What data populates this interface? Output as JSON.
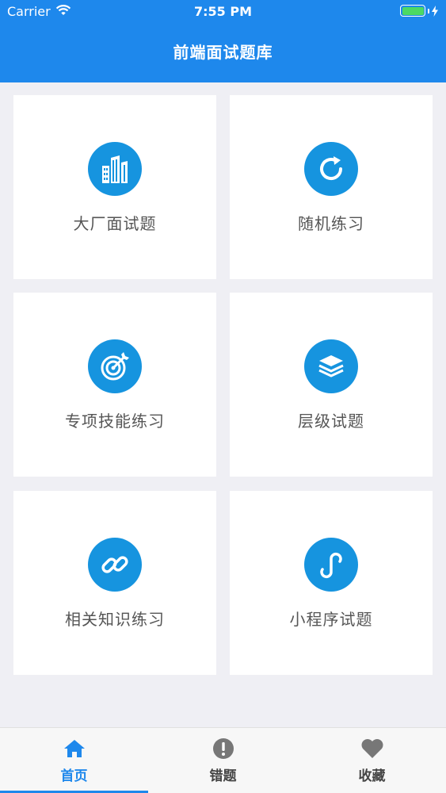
{
  "status_bar": {
    "carrier": "Carrier",
    "time": "7:55 PM"
  },
  "nav": {
    "title": "前端面试题库"
  },
  "grid": [
    {
      "label": "大厂面试题",
      "icon": "building-icon"
    },
    {
      "label": "随机练习",
      "icon": "refresh-icon"
    },
    {
      "label": "专项技能练习",
      "icon": "target-icon"
    },
    {
      "label": "层级试题",
      "icon": "layers-icon"
    },
    {
      "label": "相关知识练习",
      "icon": "link-icon"
    },
    {
      "label": "小程序试题",
      "icon": "mini-program-icon"
    }
  ],
  "tabbar": {
    "items": [
      {
        "label": "首页",
        "icon": "home-icon",
        "active": true
      },
      {
        "label": "错题",
        "icon": "exclamation-icon",
        "active": false
      },
      {
        "label": "收藏",
        "icon": "heart-icon",
        "active": false
      }
    ]
  },
  "colors": {
    "primary": "#1e88ec",
    "icon_circle": "#1694df",
    "background": "#efeff4",
    "battery": "#4cd964"
  }
}
